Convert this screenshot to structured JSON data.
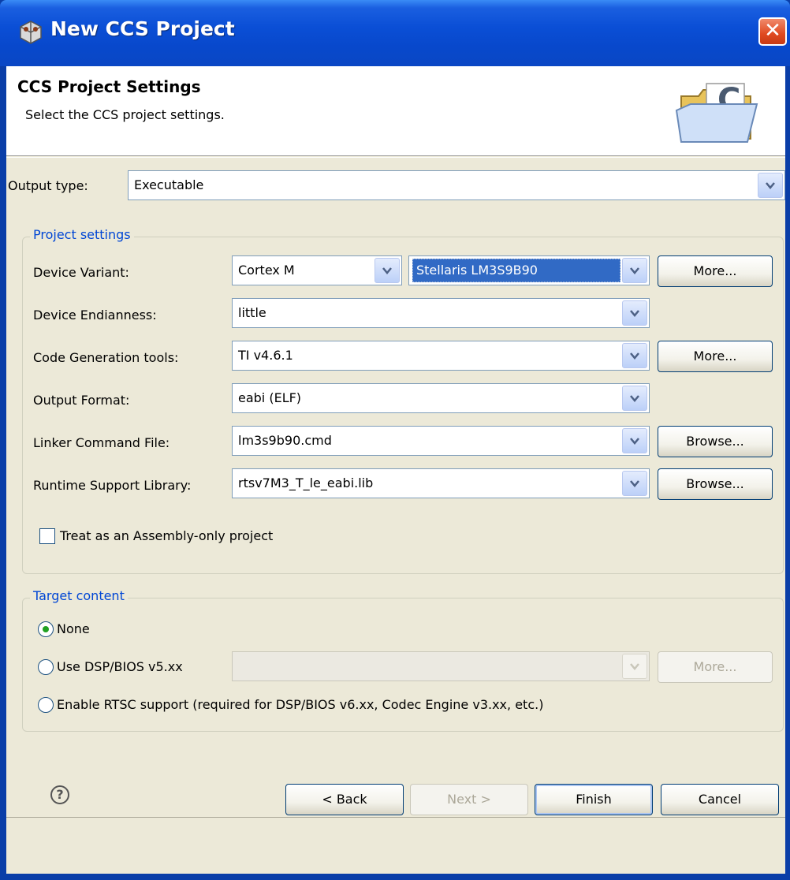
{
  "window": {
    "title": "New CCS Project",
    "close_label": "✕"
  },
  "banner": {
    "title": "CCS Project Settings",
    "description": "Select the CCS project settings."
  },
  "output_type": {
    "label": "Output type:",
    "value": "Executable"
  },
  "project_settings": {
    "title": "Project settings",
    "device_variant": {
      "label": "Device Variant:",
      "family": "Cortex M",
      "device": "Stellaris LM3S9B90",
      "more": "More..."
    },
    "device_endianness": {
      "label": "Device Endianness:",
      "value": "little"
    },
    "codegen_tools": {
      "label": "Code Generation tools:",
      "value": "TI v4.6.1",
      "more": "More..."
    },
    "output_format": {
      "label": "Output Format:",
      "value": "eabi (ELF)"
    },
    "linker_cmd": {
      "label": "Linker Command File:",
      "value": "lm3s9b90.cmd",
      "browse": "Browse..."
    },
    "runtime_lib": {
      "label": "Runtime Support Library:",
      "value": "rtsv7M3_T_le_eabi.lib",
      "browse": "Browse..."
    },
    "assembly_only": {
      "label": "Treat as an Assembly-only project",
      "checked": false
    }
  },
  "target_content": {
    "title": "Target content",
    "none": "None",
    "dsp_bios": "Use DSP/BIOS v5.xx",
    "dsp_more": "More...",
    "rtsc": "Enable RTSC support (required for DSP/BIOS v6.xx, Codec Engine v3.xx, etc.)",
    "selected": "None"
  },
  "footer": {
    "back": "< Back",
    "next": "Next >",
    "finish": "Finish",
    "cancel": "Cancel",
    "help_icon": "help-icon"
  },
  "colors": {
    "titlebar": "#0848cc",
    "group_title": "#0046d5",
    "selection": "#316ac5",
    "dialog_bg": "#ece9d8"
  }
}
